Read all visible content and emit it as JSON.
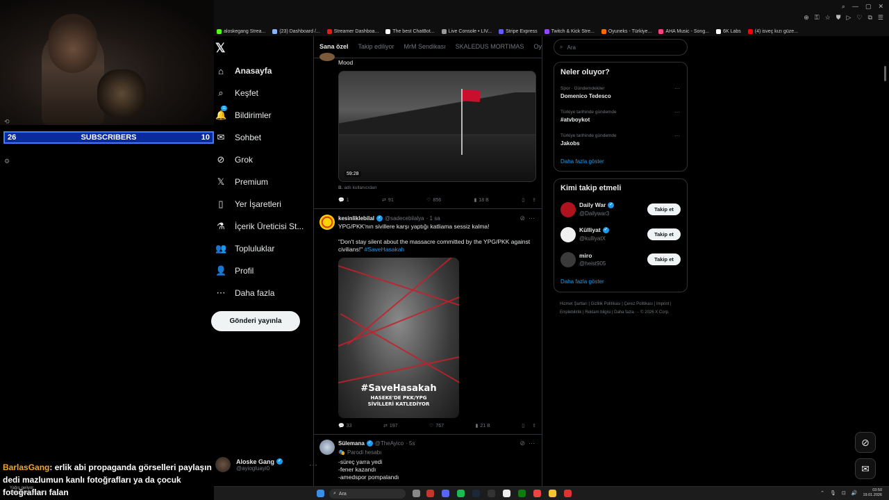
{
  "bookmarks": [
    {
      "label": "aloskegang Strea...",
      "color": "#53fc18"
    },
    {
      "label": "(23) Dashboard /...",
      "color": "#8ab4f8"
    },
    {
      "label": "Streamer Dashboa...",
      "color": "#e91916"
    },
    {
      "label": "The best ChatBot...",
      "color": "#ffffff"
    },
    {
      "label": "Live Console • LIV...",
      "color": "#999999"
    },
    {
      "label": "Stripe Express",
      "color": "#635bff"
    },
    {
      "label": "Twitch & Kick Stre...",
      "color": "#9146ff"
    },
    {
      "label": "Oyuneks - Türkiye...",
      "color": "#ff6a00"
    },
    {
      "label": "AHA Music - Song...",
      "color": "#ff4081"
    },
    {
      "label": "6K Labs",
      "color": "#ffffff"
    },
    {
      "label": "(4) isveç kızı güze...",
      "color": "#ff0000"
    }
  ],
  "stream": {
    "subscribers_left": "26",
    "subscribers_label": "SUBSCRIBERS",
    "subscribers_right": "10",
    "chat_user": "BarlasGang",
    "chat_text": ": erlik abi propaganda görselleri paylaşın dedi mazlumun kanlı fotoğrafları ya da çocuk fotoğrafları falan",
    "toast_line1": "Yağış geliyor",
    "toast_line2": "Gökdelek 1,5 saat..."
  },
  "nav": {
    "items": [
      {
        "label": "Anasayfa",
        "icon": "home-icon",
        "glyph": "⌂"
      },
      {
        "label": "Keşfet",
        "icon": "search-icon",
        "glyph": "⌕"
      },
      {
        "label": "Bildirimler",
        "icon": "bell-icon",
        "glyph": "🔔"
      },
      {
        "label": "Sohbet",
        "icon": "mail-icon",
        "glyph": "✉"
      },
      {
        "label": "Grok",
        "icon": "grok-icon",
        "glyph": "⊘"
      },
      {
        "label": "Premium",
        "icon": "x-premium-icon",
        "glyph": "𝕏"
      },
      {
        "label": "Yer İşaretleri",
        "icon": "bookmark-icon",
        "glyph": "▯"
      },
      {
        "label": "İçerik Üreticisi St...",
        "icon": "flask-icon",
        "glyph": "⚗"
      },
      {
        "label": "Topluluklar",
        "icon": "people-icon",
        "glyph": "👥"
      },
      {
        "label": "Profil",
        "icon": "person-icon",
        "glyph": "👤"
      },
      {
        "label": "Daha fazla",
        "icon": "more-circle-icon",
        "glyph": "⋯"
      }
    ],
    "notif_badge": "11",
    "post_label": "Gönderi yayınla",
    "account_name": "Aloske Gang",
    "account_handle": "@ayiogluayi0"
  },
  "feed": {
    "tabs": [
      "Sana özel",
      "Takip ediliyor",
      "MrM Sendikası",
      "SKALEDUS MORTIMAS",
      "Oyu"
    ],
    "tweet1": {
      "text": "Mood",
      "duration": "59:28",
      "from_label": "adlı kullanıcıdan",
      "from_prefix": "B.",
      "replies": "1",
      "retweets": "91",
      "likes": "856",
      "views": "18 B"
    },
    "tweet2": {
      "name": "kesinliklebilal",
      "handle": "@sadecebilalya",
      "time": "· 1 sa",
      "text1": "YPG/PKK'nın sivillere karşı yaptığı katliama sessiz kalma!",
      "text2": "\"Don't stay silent about the massacre committed by the YPG/PKK against civilians!\"",
      "hashtag": "#SaveHasakah",
      "art_title": "#SaveHasakah",
      "art_sub1": "HASEKE'DE PKK/YPG",
      "art_sub2": "SİVİLLERİ KATLEDİYOR",
      "replies": "33",
      "retweets": "197",
      "likes": "767",
      "views": "21 B"
    },
    "tweet3": {
      "name": "Sülemana",
      "handle": "@TheAyico",
      "time": "· 5s",
      "badge": "Parodi hesabı",
      "lines": [
        "-süreç yarra yedi",
        "-fener kazandı",
        "-amedspor pompalandı"
      ]
    }
  },
  "right": {
    "search_placeholder": "Ara",
    "trends_title": "Neler oluyor?",
    "trends": [
      {
        "meta": "Spor · Gündemdekiler",
        "name": "Domenico Tedesco"
      },
      {
        "meta": "Türkiye tarihinde gündemde",
        "name": "#atvboykot"
      },
      {
        "meta": "Türkiye tarihinde gündemde",
        "name": "Jakobs"
      }
    ],
    "show_more": "Daha fazla göster",
    "who_title": "Kimi takip etmeli",
    "who": [
      {
        "name": "Daily War",
        "handle": "@Dailywar3",
        "color": "#b0131d"
      },
      {
        "name": "Külliyat",
        "handle": "@kulliyatX",
        "color": "#f0f0f0"
      },
      {
        "name": "miro",
        "handle": "@heist905",
        "color": "#3a3a3a"
      }
    ],
    "follow_label": "Takip et",
    "footer": "Hizmet Şartları  |  Gizlilik Politikası  |  Çerez Politikası  |  Imprint  |  Erişilebilirlik  |  Reklam bilgisi  |  Daha fazla ···  © 2026 X Corp."
  },
  "taskbar": {
    "search": "Ara",
    "time": "03:50",
    "date": "19.01.2026"
  }
}
